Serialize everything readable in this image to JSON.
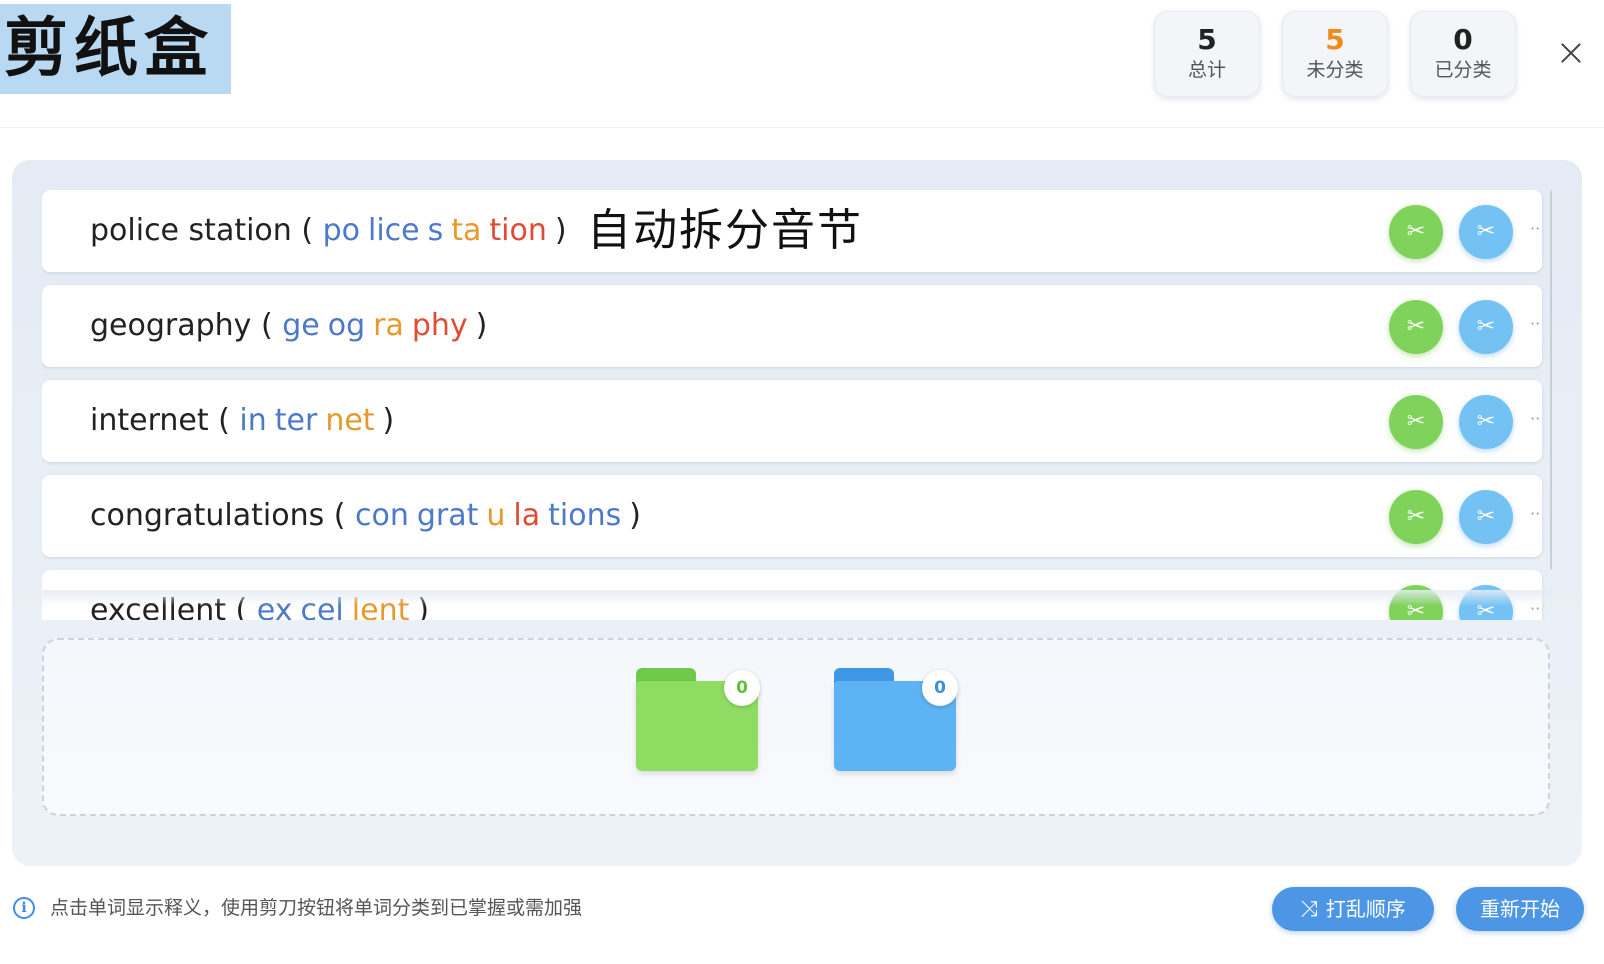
{
  "header": {
    "app_title": "剪纸盒",
    "stats": [
      {
        "value": "5",
        "label": "总计",
        "color": "#222222"
      },
      {
        "value": "5",
        "label": "未分类",
        "color": "#f08a1a"
      },
      {
        "value": "0",
        "label": "已分类",
        "color": "#222222"
      }
    ],
    "close_icon": "close-icon"
  },
  "words": [
    {
      "word": "police station",
      "syllables": [
        {
          "text": "po",
          "color": "blue"
        },
        {
          "text": "lice",
          "color": "blue"
        },
        {
          "text": "s",
          "color": "blue"
        },
        {
          "text": "ta",
          "color": "orange"
        },
        {
          "text": "tion",
          "color": "red"
        }
      ],
      "note": "自动拆分音节"
    },
    {
      "word": "geography",
      "syllables": [
        {
          "text": "ge",
          "color": "blue"
        },
        {
          "text": "og",
          "color": "blue"
        },
        {
          "text": "ra",
          "color": "orange"
        },
        {
          "text": "phy",
          "color": "red"
        }
      ]
    },
    {
      "word": "internet",
      "syllables": [
        {
          "text": "in",
          "color": "blue"
        },
        {
          "text": "ter",
          "color": "blue"
        },
        {
          "text": "net",
          "color": "orange"
        }
      ]
    },
    {
      "word": "congratulations",
      "syllables": [
        {
          "text": "con",
          "color": "blue"
        },
        {
          "text": "grat",
          "color": "blue"
        },
        {
          "text": "u",
          "color": "orange"
        },
        {
          "text": "la",
          "color": "red"
        },
        {
          "text": "tions",
          "color": "blue"
        }
      ]
    },
    {
      "word": "excellent",
      "syllables": [
        {
          "text": "ex",
          "color": "blue"
        },
        {
          "text": "cel",
          "color": "blue"
        },
        {
          "text": "lent",
          "color": "orange"
        }
      ]
    }
  ],
  "row_actions": {
    "green_icon": "scissors-icon",
    "blue_icon": "scissors-icon"
  },
  "folders": [
    {
      "name": "green-folder",
      "count": "0",
      "color": "#8fdc63"
    },
    {
      "name": "blue-folder",
      "count": "0",
      "color": "#5db3f3"
    }
  ],
  "footer": {
    "hint": "点击单词显示释义，使用剪刀按钮将单词分类到已掌握或需加强",
    "shuffle_label": "打乱顺序",
    "restart_label": "重新开始"
  },
  "colors": {
    "accent": "#4d96e6",
    "green": "#7fd35a",
    "blue": "#74c2f3",
    "orange": "#f08a1a"
  }
}
